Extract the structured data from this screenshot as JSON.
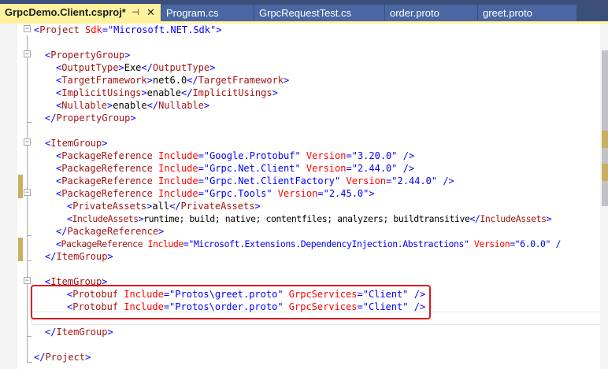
{
  "tabs": [
    {
      "label": "GrpcDemo.Client.csproj*",
      "active": true,
      "pin_glyph": "⊣",
      "close_glyph": "✕"
    },
    {
      "label": "Program.cs"
    },
    {
      "label": "GrpcRequestTest.cs"
    },
    {
      "label": "order.proto"
    },
    {
      "label": "greet.proto"
    }
  ],
  "colors": {
    "active_tab_bg": "#fff29d",
    "inactive_tab_bg": "#4a66a3",
    "tabstrip_bg": "#3c4f7a",
    "xml_bracket": "#0000ff",
    "xml_tag": "#a31515",
    "xml_attr": "#ff0000",
    "xml_value": "#0000ff",
    "highlight_box": "#e0161e",
    "change_marker": "#c8b060"
  },
  "code": {
    "l1": {
      "b1": "<",
      "t1": "Project",
      "a1": " Sdk",
      "e1": "=\"",
      "v1": "Microsoft.NET.Sdk",
      "e2": "\"",
      "b2": ">"
    },
    "l3": {
      "b1": "<",
      "t1": "PropertyGroup",
      "b2": ">"
    },
    "l4": {
      "b1": "<",
      "t1": "OutputType",
      "b2": ">",
      "x1": "Exe",
      "b3": "</",
      "t2": "OutputType",
      "b4": ">"
    },
    "l5": {
      "b1": "<",
      "t1": "TargetFramework",
      "b2": ">",
      "x1": "net6.0",
      "b3": "</",
      "t2": "TargetFramework",
      "b4": ">"
    },
    "l6": {
      "b1": "<",
      "t1": "ImplicitUsings",
      "b2": ">",
      "x1": "enable",
      "b3": "</",
      "t2": "ImplicitUsings",
      "b4": ">"
    },
    "l7": {
      "b1": "<",
      "t1": "Nullable",
      "b2": ">",
      "x1": "enable",
      "b3": "</",
      "t2": "Nullable",
      "b4": ">"
    },
    "l8": {
      "b1": "</",
      "t1": "PropertyGroup",
      "b2": ">"
    },
    "l10": {
      "b1": "<",
      "t1": "ItemGroup",
      "b2": ">"
    },
    "l11": {
      "b1": "<",
      "t1": "PackageReference",
      "a1": " Include",
      "e1": "=\"",
      "v1": "Google.Protobuf",
      "e2": "\"",
      "a2": " Version",
      "e3": "=\"",
      "v2": "3.20.0",
      "e4": "\"",
      "b2": " />"
    },
    "l12": {
      "b1": "<",
      "t1": "PackageReference",
      "a1": " Include",
      "e1": "=\"",
      "v1": "Grpc.Net.Client",
      "e2": "\"",
      "a2": " Version",
      "e3": "=\"",
      "v2": "2.44.0",
      "e4": "\"",
      "b2": " />"
    },
    "l13": {
      "b1": "<",
      "t1": "PackageReference",
      "a1": " Include",
      "e1": "=\"",
      "v1": "Grpc.Net.ClientFactory",
      "e2": "\"",
      "a2": " Version",
      "e3": "=\"",
      "v2": "2.44.0",
      "e4": "\"",
      "b2": " />"
    },
    "l14": {
      "b1": "<",
      "t1": "PackageReference",
      "a1": " Include",
      "e1": "=\"",
      "v1": "Grpc.Tools",
      "e2": "\"",
      "a2": " Version",
      "e3": "=\"",
      "v2": "2.45.0",
      "e4": "\"",
      "b2": ">"
    },
    "l15": {
      "b1": "<",
      "t1": "PrivateAssets",
      "b2": ">",
      "x1": "all",
      "b3": "</",
      "t2": "PrivateAssets",
      "b4": ">"
    },
    "l16": {
      "b1": "<",
      "t1": "IncludeAssets",
      "b2": ">",
      "x1": "runtime; build; native; contentfiles; analyzers; buildtransitive",
      "b3": "</",
      "t2": "IncludeAssets",
      "b4": ">"
    },
    "l17": {
      "b1": "</",
      "t1": "PackageReference",
      "b2": ">"
    },
    "l18": {
      "b1": "<",
      "t1": "PackageReference",
      "a1": " Include",
      "e1": "=\"",
      "v1": "Microsoft.Extensions.DependencyInjection.Abstractions",
      "e2": "\"",
      "a2": " Version",
      "e3": "=\"",
      "v2": "6.0.0",
      "e4": "\"",
      "b2": " /"
    },
    "l19": {
      "b1": "</",
      "t1": "ItemGroup",
      "b2": ">"
    },
    "l21": {
      "b1": "<",
      "t1": "ItemGroup",
      "b2": ">"
    },
    "l22": {
      "b1": "<",
      "t1": "Protobuf",
      "a1": " Include",
      "e1": "=\"",
      "v1": "Protos\\greet.proto",
      "e2": "\"",
      "a2": " GrpcServices",
      "e3": "=\"",
      "v2": "Client",
      "e4": "\"",
      "b2": " />"
    },
    "l23": {
      "b1": "<",
      "t1": "Protobuf",
      "a1": " Include",
      "e1": "=\"",
      "v1": "Protos\\order.proto",
      "e2": "\"",
      "a2": " GrpcServices",
      "e3": "=\"",
      "v2": "Client",
      "e4": "\"",
      "b2": " />"
    },
    "l25": {
      "b1": "</",
      "t1": "ItemGroup",
      "b2": ">"
    },
    "l27": {
      "b1": "</",
      "t1": "Project",
      "b2": ">"
    }
  }
}
